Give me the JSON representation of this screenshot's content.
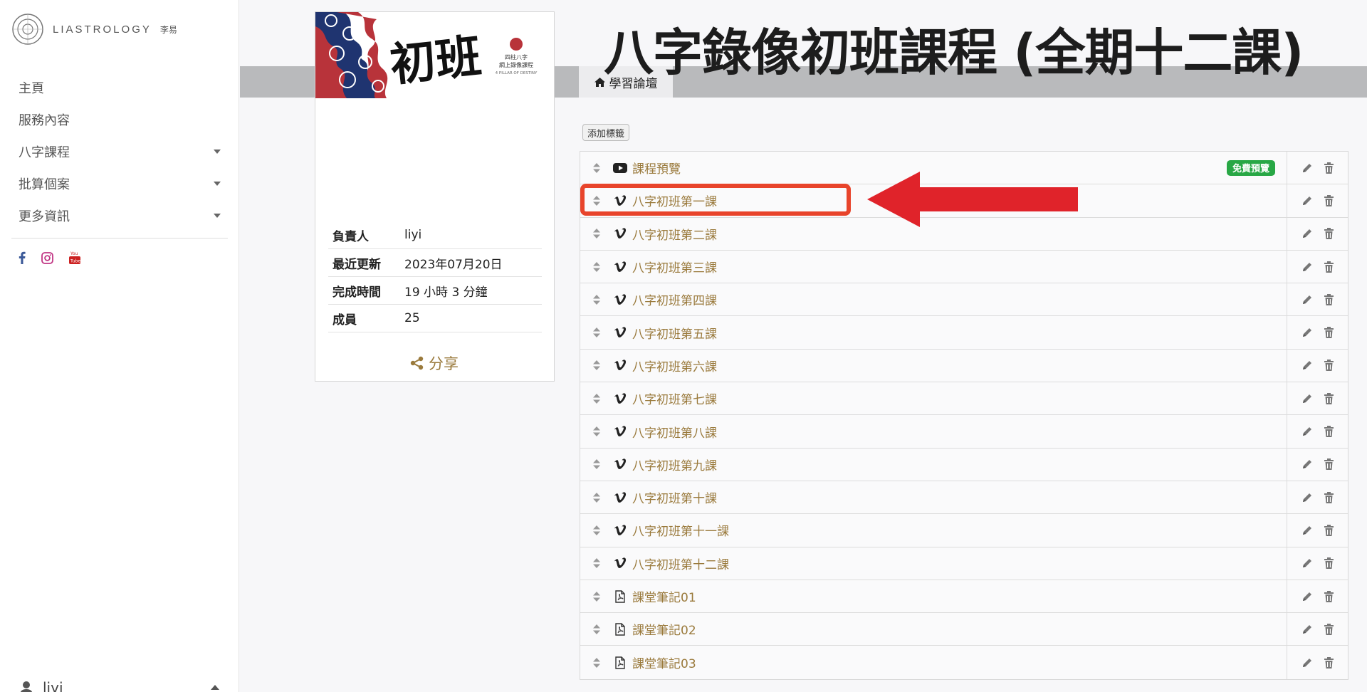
{
  "brand": {
    "name": "LIASTROLOGY",
    "sub": "李易"
  },
  "sidebar": {
    "items": [
      {
        "label": "主頁"
      },
      {
        "label": "服務內容"
      },
      {
        "label": "八字課程"
      },
      {
        "label": "批算個案"
      },
      {
        "label": "更多資訊"
      }
    ],
    "social_icons": [
      "facebook-icon",
      "instagram-icon",
      "youtube-icon"
    ],
    "user": {
      "name": "liyi"
    }
  },
  "header": {
    "title": "八字錄像初班課程 (全期十二課)",
    "breadcrumb": "學習論壇"
  },
  "course_card": {
    "banner": {
      "calligraphy": "初班",
      "subtitle_line1": "四柱八字",
      "subtitle_line2": "網上錄像課程",
      "subtitle_line3": "4 PILLAR OF DESTINY"
    },
    "info": [
      {
        "label": "負責人",
        "value": "liyi"
      },
      {
        "label": "最近更新",
        "value": "2023年07月20日"
      },
      {
        "label": "完成時間",
        "value": "19 小時 3 分鐘"
      },
      {
        "label": "成員",
        "value": "25"
      }
    ],
    "share_label": "分享"
  },
  "toolbar": {
    "add_tag_label": "添加標籤"
  },
  "lessons": [
    {
      "title": "課程預覽",
      "type": "youtube",
      "badge": "免費預覽"
    },
    {
      "title": "八字初班第一課",
      "type": "vimeo"
    },
    {
      "title": "八字初班第二課",
      "type": "vimeo"
    },
    {
      "title": "八字初班第三課",
      "type": "vimeo"
    },
    {
      "title": "八字初班第四課",
      "type": "vimeo"
    },
    {
      "title": "八字初班第五課",
      "type": "vimeo"
    },
    {
      "title": "八字初班第六課",
      "type": "vimeo"
    },
    {
      "title": "八字初班第七課",
      "type": "vimeo"
    },
    {
      "title": "八字初班第八課",
      "type": "vimeo"
    },
    {
      "title": "八字初班第九課",
      "type": "vimeo"
    },
    {
      "title": "八字初班第十課",
      "type": "vimeo"
    },
    {
      "title": "八字初班第十一課",
      "type": "vimeo"
    },
    {
      "title": "八字初班第十二課",
      "type": "vimeo"
    },
    {
      "title": "課堂筆記01",
      "type": "pdf"
    },
    {
      "title": "課堂筆記02",
      "type": "pdf"
    },
    {
      "title": "課堂筆記03",
      "type": "pdf"
    }
  ],
  "colors": {
    "link": "#9a7a3c",
    "badge": "#28a745",
    "annotation": "#e8442b",
    "banner_navy": "#1f3470",
    "banner_red": "#b8333a"
  }
}
